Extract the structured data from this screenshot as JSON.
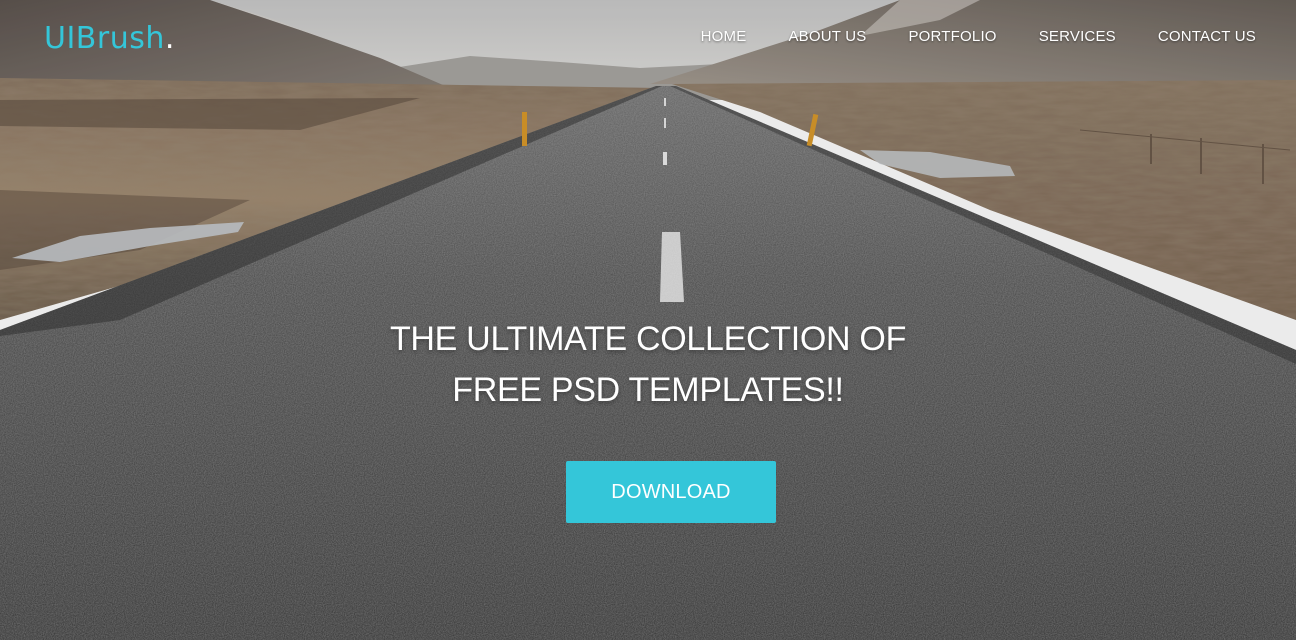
{
  "brand": {
    "name": "UIBrush",
    "dot": ".",
    "accent_color": "#34c6d9"
  },
  "nav": {
    "items": [
      {
        "label": "HOME"
      },
      {
        "label": "ABOUT US"
      },
      {
        "label": "PORTFOLIO"
      },
      {
        "label": "SERVICES"
      },
      {
        "label": "CONTACT US"
      }
    ]
  },
  "hero": {
    "headline_line1": "THE ULTIMATE COLLECTION OF",
    "headline_line2": "FREE PSD TEMPLATES!!",
    "cta_label": "DOWNLOAD",
    "background_scene": "empty road through barren landscape"
  }
}
